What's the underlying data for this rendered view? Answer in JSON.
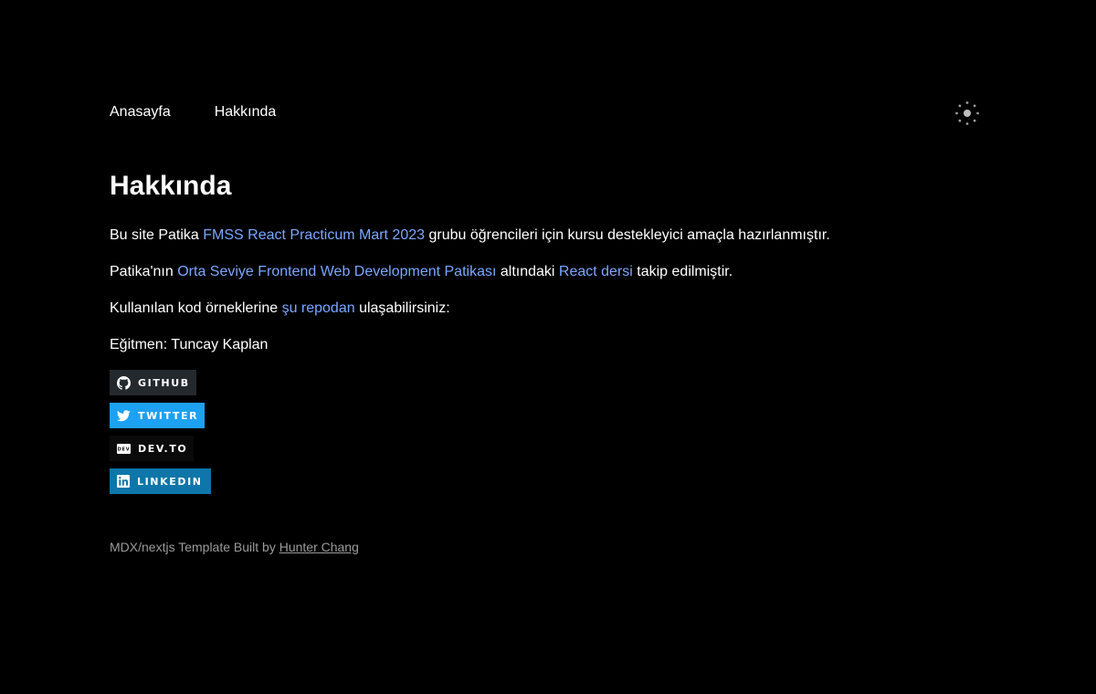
{
  "nav": {
    "home_label": "Anasayfa",
    "about_label": "Hakkında"
  },
  "theme_toggle": {
    "icon": "sun-icon"
  },
  "page": {
    "title": "Hakkında",
    "p1": {
      "before": "Bu site Patika ",
      "link": "FMSS React Practicum Mart 2023",
      "after": " grubu öğrencileri için kursu destekleyici amaçla hazırlanmıştır."
    },
    "p2": {
      "before": "Patika'nın ",
      "link1": "Orta Seviye Frontend Web Development Patikası",
      "middle": " altındaki ",
      "link2": "React dersi",
      "after": " takip edilmiştir."
    },
    "p3": {
      "before": "Kullanılan kod örneklerine ",
      "link": "şu repodan",
      "after": " ulaşabilirsiniz:"
    },
    "p4": "Eğitmen: Tuncay Kaplan"
  },
  "badges": [
    {
      "label": "GITHUB",
      "icon": "github-icon",
      "color": "#24292e"
    },
    {
      "label": "TWITTER",
      "icon": "twitter-icon",
      "color": "#1da1f2"
    },
    {
      "label": "DEV.TO",
      "icon": "devto-icon",
      "color": "#0a0a0a"
    },
    {
      "label": "LINKEDIN",
      "icon": "linkedin-icon",
      "color": "#0e76a8"
    }
  ],
  "footer": {
    "text": "MDX/nextjs Template Built by ",
    "link": "Hunter Chang"
  },
  "colors": {
    "background": "#000000",
    "text": "#ffffff",
    "link": "#7aa7ff",
    "muted": "#9a9a9a"
  }
}
